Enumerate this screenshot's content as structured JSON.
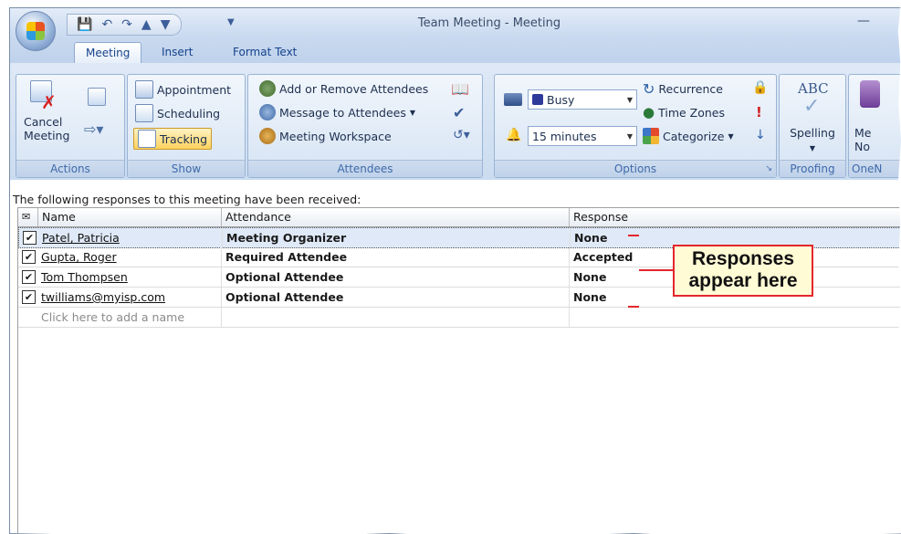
{
  "window": {
    "title": "Team Meeting - Meeting",
    "minimize_icon": "minimize-icon"
  },
  "quick_access": {
    "icons": [
      "save-icon",
      "undo-icon",
      "redo-icon",
      "previous-item-icon",
      "next-item-icon"
    ]
  },
  "tabs": [
    {
      "label": "Meeting",
      "active": true
    },
    {
      "label": "Insert",
      "active": false
    },
    {
      "label": "Format Text",
      "active": false
    }
  ],
  "groups": {
    "actions": {
      "label": "Actions",
      "cancel_label_1": "Cancel",
      "cancel_label_2": "Meeting"
    },
    "show": {
      "label": "Show",
      "appointment": "Appointment",
      "scheduling": "Scheduling",
      "tracking": "Tracking"
    },
    "attendees": {
      "label": "Attendees",
      "add_remove": "Add or Remove Attendees",
      "message": "Message to Attendees",
      "workspace": "Meeting Workspace"
    },
    "options": {
      "label": "Options",
      "show_as": "Busy",
      "reminder": "15 minutes",
      "recurrence": "Recurrence",
      "time_zones": "Time Zones",
      "categorize": "Categorize"
    },
    "proofing": {
      "label": "Proofing",
      "spelling": "Spelling",
      "abc": "ABC"
    },
    "onenote": {
      "label": "OneN",
      "btn_1": "Me",
      "btn_2": "No"
    }
  },
  "content": {
    "intro": "The following responses to this meeting have been received:",
    "columns": {
      "name": "Name",
      "attendance": "Attendance",
      "response": "Response"
    },
    "rows": [
      {
        "name": "Patel, Patricia",
        "attendance": "Meeting Organizer",
        "response": "None",
        "checked": true
      },
      {
        "name": "Gupta, Roger",
        "attendance": "Required Attendee",
        "response": "Accepted",
        "checked": true
      },
      {
        "name": "Tom Thompsen",
        "attendance": "Optional Attendee",
        "response": "None",
        "checked": true
      },
      {
        "name": "twilliams@myisp.com",
        "attendance": "Optional Attendee",
        "response": "None",
        "checked": true
      }
    ],
    "add_name": "Click here to add a name"
  },
  "callout": {
    "line_1": "Responses",
    "line_2": "appear here",
    "color": "#e4262c"
  }
}
